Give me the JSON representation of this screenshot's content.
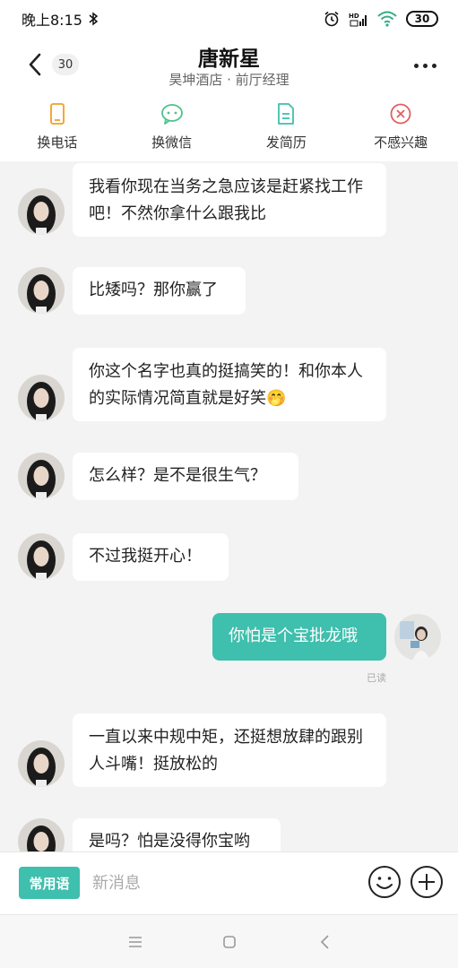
{
  "status_bar": {
    "time": "晚上8:15",
    "battery": "30",
    "network_label": "HD"
  },
  "header": {
    "unread_count": "30",
    "contact_name": "唐新星",
    "contact_subtitle": "昊坤酒店 · 前厅经理"
  },
  "actions": [
    {
      "label": "换电话",
      "icon": "phone-icon",
      "color": "#f0a020"
    },
    {
      "label": "换微信",
      "icon": "wechat-icon",
      "color": "#4cc38a"
    },
    {
      "label": "发简历",
      "icon": "resume-icon",
      "color": "#3fbfad"
    },
    {
      "label": "不感兴趣",
      "icon": "close-circle-icon",
      "color": "#e06060"
    }
  ],
  "messages": [
    {
      "from": "them",
      "text": "我看你现在当务之急应该是赶紧找工作吧！不然你拿什么跟我比"
    },
    {
      "from": "them",
      "text": "比矮吗？那你赢了"
    },
    {
      "from": "them",
      "text": "你这个名字也真的挺搞笑的！和你本人的实际情况简直就是好笑🤭"
    },
    {
      "from": "them",
      "text": "怎么样？是不是很生气？"
    },
    {
      "from": "them",
      "text": "不过我挺开心！"
    },
    {
      "from": "me",
      "text": "你怕是个宝批龙哦",
      "status": "已读"
    },
    {
      "from": "them",
      "text": "一直以来中规中矩，还挺想放肆的跟别人斗嘴！挺放松的"
    },
    {
      "from": "them",
      "text": "是吗？怕是没得你宝哟"
    }
  ],
  "input_bar": {
    "phrases_label": "常用语",
    "placeholder": "新消息"
  },
  "colors": {
    "accent": "#3fbfad",
    "chat_bg": "#f3f3f3"
  }
}
